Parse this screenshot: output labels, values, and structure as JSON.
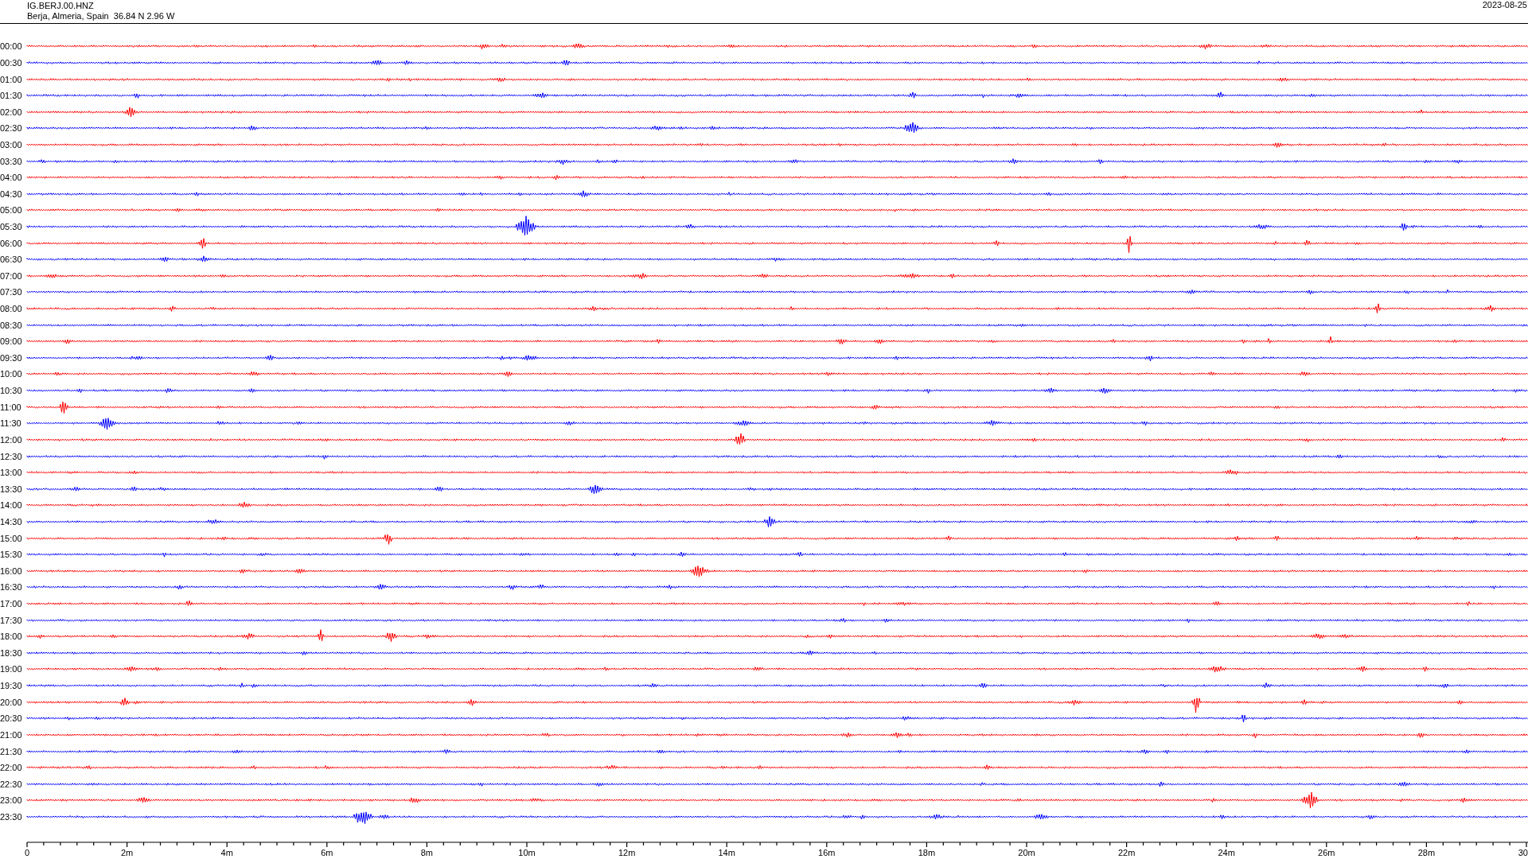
{
  "header": {
    "station": "IG.BERJ.00.HNZ",
    "location": "Berja, Almeria, Spain  36.84 N 2.96 W",
    "date": "2023-08-25"
  },
  "helicorder": {
    "rows": [
      {
        "label": "00:00",
        "color": "#ff0000"
      },
      {
        "label": "00:30",
        "color": "#0000ff"
      },
      {
        "label": "01:00",
        "color": "#ff0000"
      },
      {
        "label": "01:30",
        "color": "#0000ff"
      },
      {
        "label": "02:00",
        "color": "#ff0000"
      },
      {
        "label": "02:30",
        "color": "#0000ff"
      },
      {
        "label": "03:00",
        "color": "#ff0000"
      },
      {
        "label": "03:30",
        "color": "#0000ff"
      },
      {
        "label": "04:00",
        "color": "#ff0000"
      },
      {
        "label": "04:30",
        "color": "#0000ff"
      },
      {
        "label": "05:00",
        "color": "#ff0000"
      },
      {
        "label": "05:30",
        "color": "#0000ff"
      },
      {
        "label": "06:00",
        "color": "#ff0000"
      },
      {
        "label": "06:30",
        "color": "#0000ff"
      },
      {
        "label": "07:00",
        "color": "#ff0000"
      },
      {
        "label": "07:30",
        "color": "#0000ff"
      },
      {
        "label": "08:00",
        "color": "#ff0000"
      },
      {
        "label": "08:30",
        "color": "#0000ff"
      },
      {
        "label": "09:00",
        "color": "#ff0000"
      },
      {
        "label": "09:30",
        "color": "#0000ff"
      },
      {
        "label": "10:00",
        "color": "#ff0000"
      },
      {
        "label": "10:30",
        "color": "#0000ff"
      },
      {
        "label": "11:00",
        "color": "#ff0000"
      },
      {
        "label": "11:30",
        "color": "#0000ff"
      },
      {
        "label": "12:00",
        "color": "#ff0000"
      },
      {
        "label": "12:30",
        "color": "#0000ff"
      },
      {
        "label": "13:00",
        "color": "#ff0000"
      },
      {
        "label": "13:30",
        "color": "#0000ff"
      },
      {
        "label": "14:00",
        "color": "#ff0000"
      },
      {
        "label": "14:30",
        "color": "#0000ff"
      },
      {
        "label": "15:00",
        "color": "#ff0000"
      },
      {
        "label": "15:30",
        "color": "#0000ff"
      },
      {
        "label": "16:00",
        "color": "#ff0000"
      },
      {
        "label": "16:30",
        "color": "#0000ff"
      },
      {
        "label": "17:00",
        "color": "#ff0000"
      },
      {
        "label": "17:30",
        "color": "#0000ff"
      },
      {
        "label": "18:00",
        "color": "#ff0000"
      },
      {
        "label": "18:30",
        "color": "#0000ff"
      },
      {
        "label": "19:00",
        "color": "#ff0000"
      },
      {
        "label": "19:30",
        "color": "#0000ff"
      },
      {
        "label": "20:00",
        "color": "#ff0000"
      },
      {
        "label": "20:30",
        "color": "#0000ff"
      },
      {
        "label": "21:00",
        "color": "#ff0000"
      },
      {
        "label": "21:30",
        "color": "#0000ff"
      },
      {
        "label": "22:00",
        "color": "#ff0000"
      },
      {
        "label": "22:30",
        "color": "#0000ff"
      },
      {
        "label": "23:00",
        "color": "#ff0000"
      },
      {
        "label": "23:30",
        "color": "#0000ff"
      }
    ],
    "x_axis_labels": [
      "0",
      "2m",
      "4m",
      "6m",
      "8m",
      "10m",
      "12m",
      "14m",
      "16m",
      "18m",
      "20m",
      "22m",
      "24m",
      "26m",
      "28m",
      "30"
    ]
  }
}
